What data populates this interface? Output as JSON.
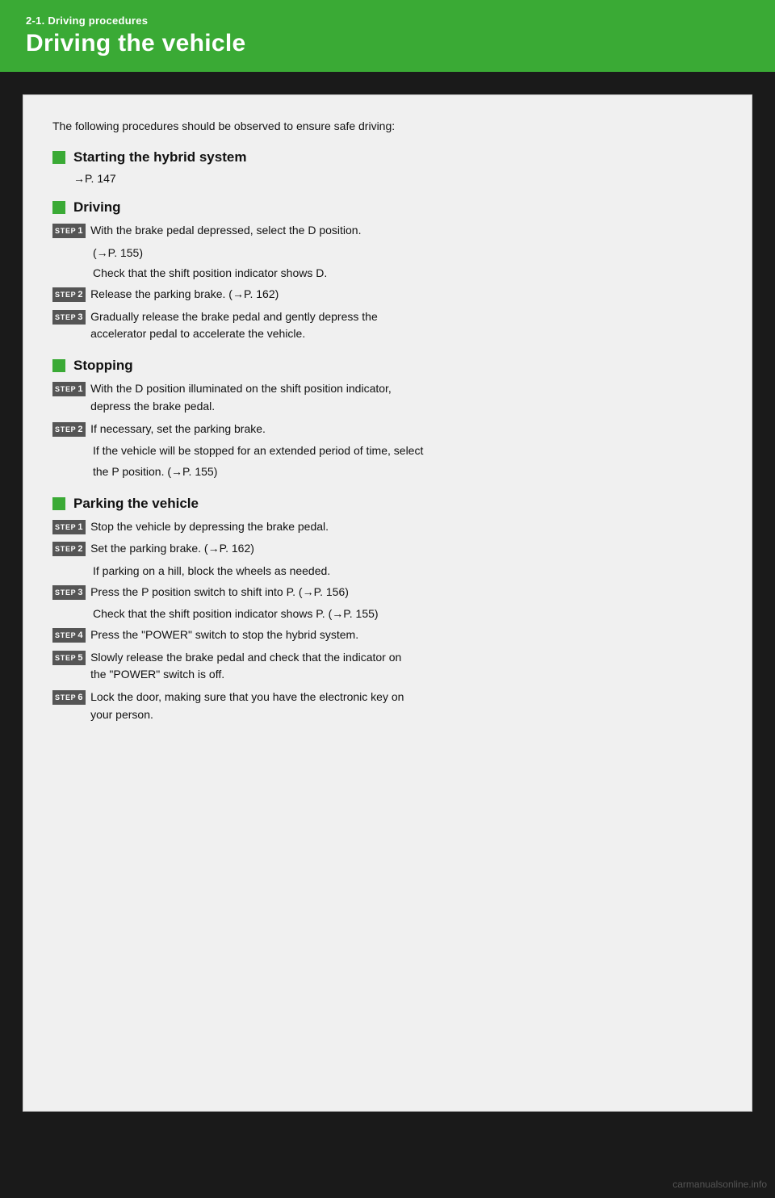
{
  "header": {
    "subtitle": "2-1.  Driving procedures",
    "title": "Driving the vehicle"
  },
  "intro": "The following procedures should be observed to ensure safe driving:",
  "sections": [
    {
      "id": "starting",
      "title": "Starting the hybrid system",
      "ref": "→P. 147",
      "steps": []
    },
    {
      "id": "driving",
      "title": "Driving",
      "ref": null,
      "steps": [
        {
          "num": "1",
          "text": "With the brake pedal depressed, select the D position.",
          "indent_lines": [
            "(→P. 155)",
            "Check that the shift position indicator shows D."
          ]
        },
        {
          "num": "2",
          "text": "Release the parking brake. (→P. 162)",
          "indent_lines": []
        },
        {
          "num": "3",
          "text": "Gradually release the brake pedal and gently depress the",
          "indent_lines": [
            "accelerator pedal to accelerate the vehicle."
          ]
        }
      ]
    },
    {
      "id": "stopping",
      "title": "Stopping",
      "ref": null,
      "steps": [
        {
          "num": "1",
          "text": "With the D position illuminated on the shift position indicator,",
          "indent_lines": [
            "depress the brake pedal."
          ]
        },
        {
          "num": "2",
          "text": "If necessary, set the parking brake.",
          "indent_lines": [
            "If the vehicle will be stopped for an extended period of time, select",
            "the P position. (→P. 155)"
          ]
        }
      ]
    },
    {
      "id": "parking",
      "title": "Parking the vehicle",
      "ref": null,
      "steps": [
        {
          "num": "1",
          "text": "Stop the vehicle by depressing the brake pedal.",
          "indent_lines": []
        },
        {
          "num": "2",
          "text": "Set the parking brake. (→P. 162)",
          "indent_lines": [
            "If parking on a hill, block the wheels as needed."
          ]
        },
        {
          "num": "3",
          "text": "Press the P position switch to shift into P. (→P. 156)",
          "indent_lines": [
            "Check that the shift position indicator shows P. (→P. 155)"
          ]
        },
        {
          "num": "4",
          "text": "Press the \"POWER\" switch to stop the hybrid system.",
          "indent_lines": []
        },
        {
          "num": "5",
          "text": "Slowly release the brake pedal and check that the indicator on",
          "indent_lines": [
            "the \"POWER\" switch is off."
          ]
        },
        {
          "num": "6",
          "text": "Lock the door, making sure that you have the electronic key on",
          "indent_lines": [
            "your person."
          ]
        }
      ]
    }
  ],
  "watermark": "carmanualsonline.info"
}
